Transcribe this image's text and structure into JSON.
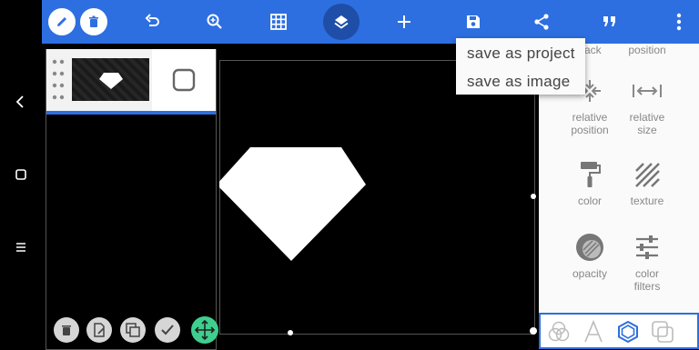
{
  "colors": {
    "toolbar": "#2d6fe0",
    "accent_green": "#3ecf8e",
    "panel_bg": "#fafafa"
  },
  "nav": {
    "icons": [
      "back-chevron-icon",
      "home-square-icon",
      "recents-lines-icon"
    ]
  },
  "toolbar": {
    "icons": [
      "pencil-icon",
      "trash-icon",
      "undo-icon",
      "zoom-in-icon",
      "grid-icon",
      "layers-icon",
      "add-icon",
      "save-icon",
      "share-icon",
      "quote-icon",
      "more-vert-icon"
    ]
  },
  "save_menu": {
    "items": [
      {
        "label": "save as project"
      },
      {
        "label": "save as image"
      }
    ]
  },
  "tools": {
    "items": [
      {
        "label": "back",
        "icon": "send-back-icon"
      },
      {
        "label": "position",
        "icon": "position-icon"
      },
      {
        "label": "relative position",
        "label2": "position",
        "label1": "relative",
        "icon": "relative-position-icon"
      },
      {
        "label1": "relative",
        "label2": "size",
        "icon": "relative-size-icon"
      },
      {
        "label1": "color",
        "icon": "paint-roller-icon"
      },
      {
        "label1": "texture",
        "icon": "texture-icon"
      },
      {
        "label1": "opacity",
        "icon": "opacity-icon"
      },
      {
        "label1": "color",
        "label2": "filters",
        "icon": "sliders-icon"
      }
    ]
  },
  "bottom_tabs": {
    "icons": [
      "blend-circles-icon",
      "text-A-icon",
      "shape-hexagon-icon",
      "layers-copy-icon"
    ],
    "active_index": 2
  },
  "layer_actions": {
    "icons": [
      "delete-layer-icon",
      "edit-layer-icon",
      "duplicate-layer-icon",
      "confirm-check-icon",
      "move-arrows-icon"
    ]
  }
}
